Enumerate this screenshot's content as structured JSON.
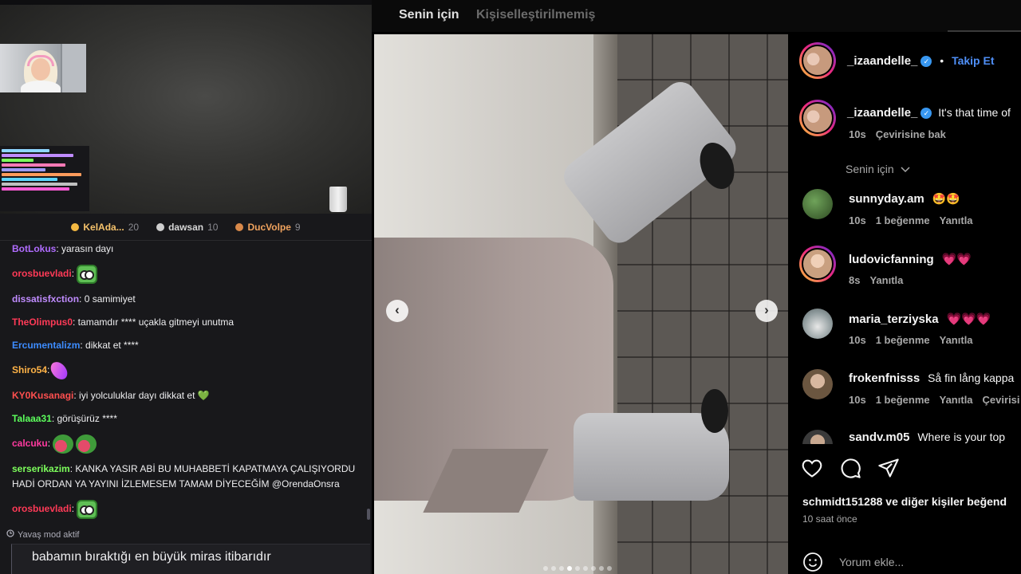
{
  "leaderboard": [
    {
      "name": "KelAda...",
      "score": "20",
      "color": "#f5c26b"
    },
    {
      "name": "dawsan",
      "score": "10",
      "color": "#d6d6d6"
    },
    {
      "name": "DucVolpe",
      "score": "9",
      "color": "#f0a35e"
    }
  ],
  "chat": [
    {
      "user": "BotLokus",
      "color": "#b06cff",
      "text": ": yarasın dayı"
    },
    {
      "user": "orosbuevladi",
      "color": "#ff3a57",
      "text": ":",
      "emotes": [
        "frog"
      ]
    },
    {
      "user": "dissatisfxction",
      "color": "#c08cff",
      "text": ": 0 samimiyet"
    },
    {
      "user": "TheOlimpus0",
      "color": "#ff3a57",
      "text": ": tamamdır **** uçakla gitmeyi unutma"
    },
    {
      "user": "Ercumentalizm",
      "color": "#3d8cff",
      "text": ": dikkat et ****"
    },
    {
      "user": "Shiro54",
      "color": "#ffb347",
      "text": ":",
      "emotes": [
        "pink"
      ]
    },
    {
      "user": "KY0Kusanagi",
      "color": "#ff4f4f",
      "text": ": iyi yolculuklar dayı dikkat et 💚"
    },
    {
      "user": "Talaaa31",
      "color": "#5cff5c",
      "text": ": görüşürüz ****"
    },
    {
      "user": "calcuku",
      "color": "#ff3aa0",
      "text": ":",
      "emotes": [
        "melon",
        "melon"
      ]
    },
    {
      "user": "serserikazim",
      "color": "#7dff5c",
      "text": ": KANKA YASIR ABİ BU MUHABBETİ KAPATMAYA ÇALIŞIYORDU HADİ ORDAN YA YAYINI İZLEMESEM TAMAM DİYECEĞİM @OrendaOnsra"
    },
    {
      "user": "orosbuevladi",
      "color": "#ff3a57",
      "text": ":",
      "emotes": [
        "frog"
      ]
    }
  ],
  "slow_mode": "Yavaş mod aktif",
  "chat_input_value": "babamın bıraktığı en büyük miras itibarıdır",
  "ig": {
    "tabs": [
      "Senin için",
      "Kişiselleştirilmemiş"
    ],
    "author": "_izaandelle_",
    "follow_label": "Takip Et",
    "caption_user": "_izaandelle_",
    "caption_text": "It's that time of",
    "caption_time": "10s",
    "caption_translate": "Çevirisine bak",
    "sort_label": "Senin için",
    "comments": [
      {
        "user": "sunnyday.am",
        "text": "🤩🤩",
        "time": "10s",
        "likes": "1 beğenme",
        "reply": "Yanıtla",
        "extra": ""
      },
      {
        "user": "ludovicfanning",
        "text": "💗💗",
        "time": "8s",
        "likes": "",
        "reply": "Yanıtla",
        "extra": ""
      },
      {
        "user": "maria_terziyska",
        "text": "💗💗💗",
        "time": "10s",
        "likes": "1 beğenme",
        "reply": "Yanıtla",
        "extra": ""
      },
      {
        "user": "frokenfnisss",
        "text": "Så fin lång kappa",
        "time": "10s",
        "likes": "1 beğenme",
        "reply": "Yanıtla",
        "extra": "Çevirisi"
      },
      {
        "user": "sandv.m05",
        "text": "Where is your top",
        "time": "",
        "likes": "",
        "reply": "",
        "extra": ""
      }
    ],
    "likes_line_user": "schmidt151288",
    "likes_line_rest": " ve diğer kişiler beğend",
    "post_time": "10 saat önce",
    "comment_placeholder": "Yorum ekle...",
    "nav_prev": "‹",
    "nav_next": "›",
    "dots": 9,
    "active_dot": 3
  }
}
